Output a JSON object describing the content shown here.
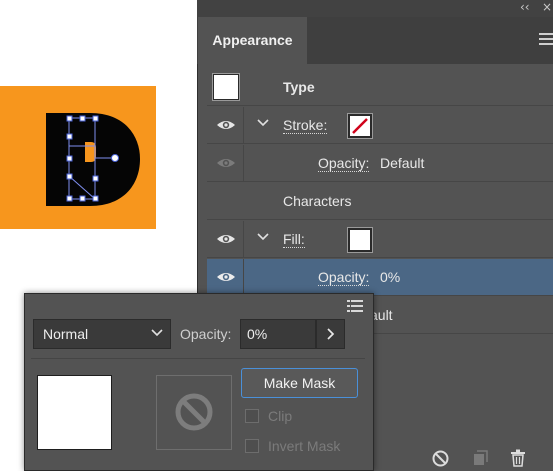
{
  "window": {
    "collapse_glyph": "‹‹",
    "close_glyph": "×"
  },
  "appearance": {
    "tab_label": "Appearance",
    "rows": {
      "type_label": "Type",
      "stroke_label": "Stroke:",
      "stroke_opacity_label": "Opacity:",
      "stroke_opacity_value": "Default",
      "characters_label": "Characters",
      "fill_label": "Fill:",
      "fill_opacity_label": "Opacity:",
      "fill_opacity_value": "0%",
      "partial_obscured_text": "ault"
    },
    "colors": {
      "panel_bg": "#535353",
      "selected_row": "#4b6785",
      "artwork_bg": "#f7961d",
      "none_swatch_slash": "#d0021b"
    }
  },
  "transparency": {
    "blend_mode": "Normal",
    "opacity_label": "Opacity:",
    "opacity_value": "0%",
    "make_mask_label": "Make Mask",
    "clip_label": "Clip",
    "invert_mask_label": "Invert Mask"
  },
  "icons": [
    "eye-icon",
    "chevron-down-icon",
    "panel-menu-icon",
    "no-entry-icon",
    "chevron-right-icon",
    "clear-appearance-icon",
    "duplicate-item-icon",
    "trash-icon"
  ]
}
